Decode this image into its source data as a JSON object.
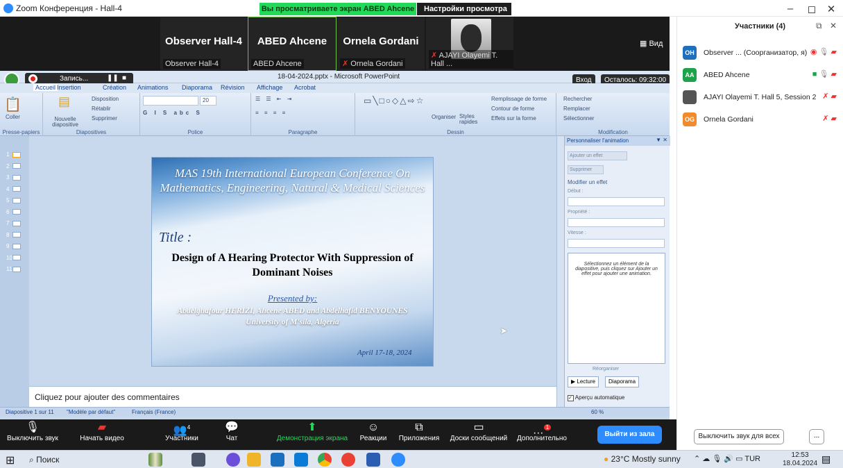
{
  "window": {
    "app_title": "Zoom Конференция - Hall-4",
    "viewing_banner": "Вы просматриваете экран ABED Ahcene",
    "view_settings": "Настройки просмотра"
  },
  "gallery": {
    "tiles": [
      {
        "big": "Observer Hall-4",
        "small": "Observer Hall-4"
      },
      {
        "big": "ABED Ahcene",
        "small": "ABED Ahcene"
      },
      {
        "big": "Ornela Gordani",
        "small": "Ornela Gordani"
      },
      {
        "big": "",
        "small": "AJAYI Olayemi T. Hall ..."
      }
    ],
    "view_btn": "Вид"
  },
  "ppt": {
    "doc_title": "18-04-2024.pptx - Microsoft PowerPoint",
    "record": "Запись...",
    "login": "Вход",
    "remaining": "Осталось: 09:32:00",
    "tabs": [
      "Accueil",
      "Insertion",
      "Création",
      "Animations",
      "Diaporama",
      "Révision",
      "Affichage",
      "Acrobat"
    ],
    "ribbon": {
      "groups": [
        {
          "label": "Presse-papiers"
        },
        {
          "label": "Diapositives"
        },
        {
          "label": "Police"
        },
        {
          "label": "Paragraphe"
        },
        {
          "label": "Dessin"
        },
        {
          "label": "Modification"
        }
      ],
      "coller": "Coller",
      "nouvelle": "Nouvelle diapositive",
      "disposition": "Disposition",
      "retablir": "Rétablir",
      "supprimer": "Supprimer",
      "font_size": "20",
      "organiser": "Organiser",
      "styles": "Styles rapides",
      "remplissage": "Remplissage de forme",
      "contour": "Contour de forme",
      "effets": "Effets sur la forme",
      "rechercher": "Rechercher",
      "remplacer": "Remplacer",
      "selectionner": "Sélectionner"
    },
    "thumbs": [
      "1",
      "2",
      "3",
      "4",
      "5",
      "6",
      "7",
      "8",
      "9",
      "10",
      "11"
    ],
    "slide": {
      "conference": "MAS 19th International European Conference On Mathematics, Engineering, Natural & Medical Sciences",
      "title_label": "Title :",
      "doc_title": "Design of A Hearing Protector With Suppression of Dominant Noises",
      "presented_by": "Presented by:",
      "authors": "Abdelghafour HERIZI, Ahcene ABED and Abdelhafid BENYOUNES",
      "university": "University of M'sila, Algeria",
      "date": "April 17-18, 2024"
    },
    "notes": "Cliquez pour ajouter des commentaires",
    "anim": {
      "header": "Personnaliser l'animation",
      "add_effect": "Ajouter un effet",
      "remove": "Supprimer",
      "modify": "Modifier un effet",
      "start": "Début :",
      "property": "Propriété :",
      "speed": "Vitesse :",
      "help": "Sélectionnez un élément de la diapositive, puis cliquez sur Ajouter un effet pour ajouter une animation.",
      "reorder": "Réorganiser",
      "play": "Lecture",
      "slideshow": "Diaporama",
      "autopreview": "Aperçu automatique"
    },
    "status": {
      "slide": "Diapositive 1 sur 11",
      "theme": "\"Modèle par défaut\"",
      "lang": "Français (France)",
      "zoom": "60 %"
    }
  },
  "toolbar": {
    "mute": "Выключить звук",
    "video": "Начать видео",
    "participants": "Участники",
    "participants_count": "4",
    "chat": "Чат",
    "share": "Демонстрация экрана",
    "reactions": "Реакции",
    "apps": "Приложения",
    "whiteboard": "Доски сообщений",
    "more": "Дополнительно",
    "more_badge": "1",
    "leave": "Выйти из зала"
  },
  "participants": {
    "header": "Участники (4)",
    "list": [
      {
        "initials": "OH",
        "name": "Observer ... (Соорганизатор, я)",
        "color": "#1f6fbf"
      },
      {
        "initials": "AA",
        "name": "ABED Ahcene",
        "color": "#1fa34a"
      },
      {
        "initials": "",
        "name": "AJAYI Olayemi T. Hall 5, Session 2",
        "color": "#555555"
      },
      {
        "initials": "OG",
        "name": "Ornela Gordani",
        "color": "#f2892b"
      }
    ],
    "mute_all": "Выключить звук для всех",
    "more": "..."
  },
  "taskbar": {
    "search": "Поиск",
    "weather": "23°C  Mostly sunny",
    "lang": "TUR",
    "time": "12:53",
    "date": "18.04.2024"
  }
}
